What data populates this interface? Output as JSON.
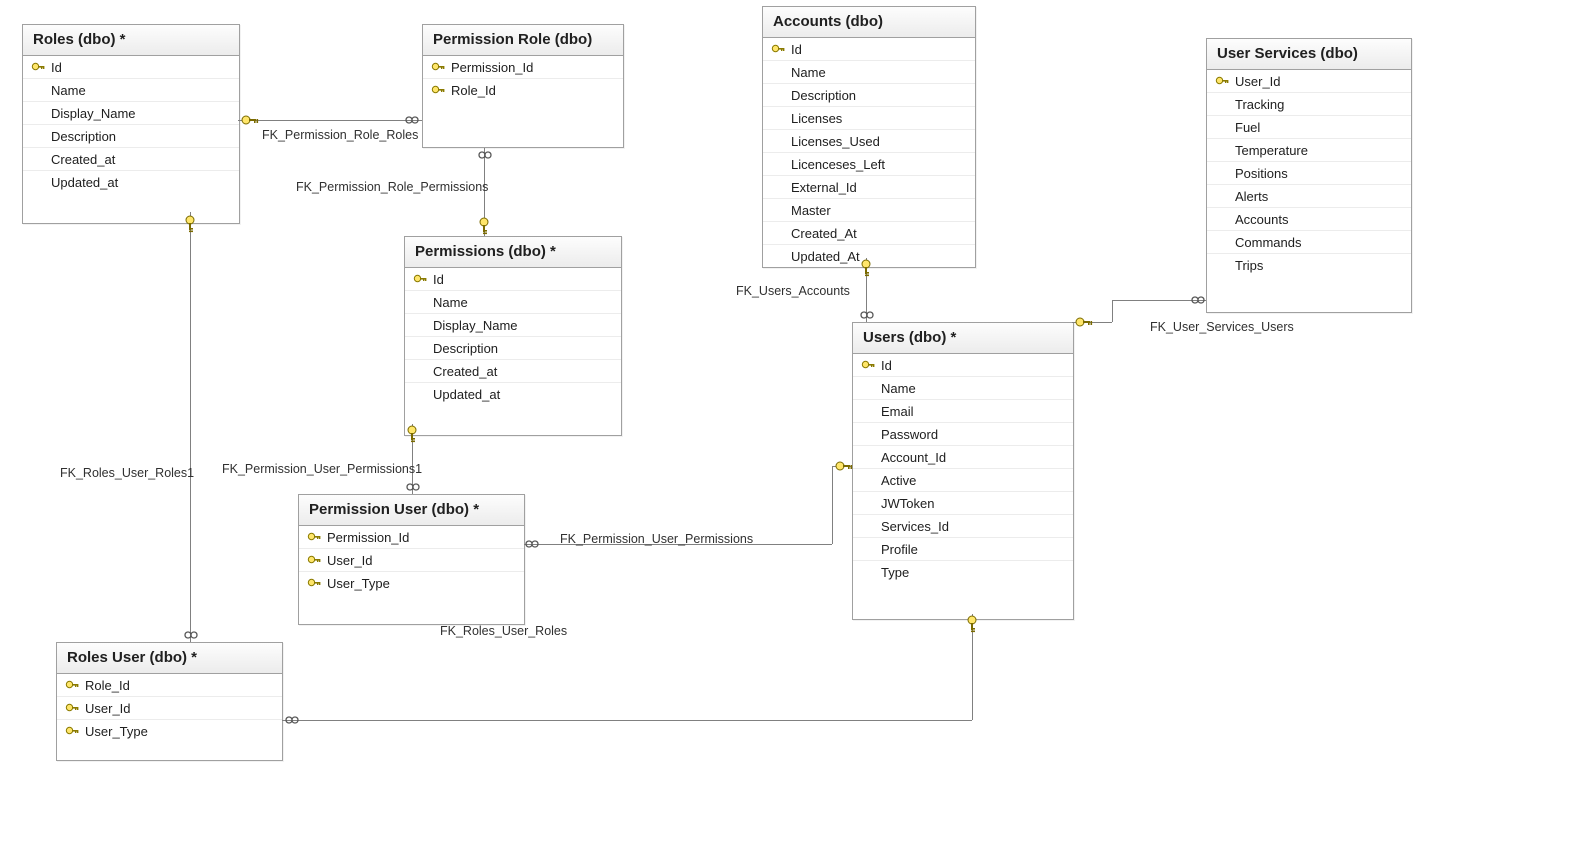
{
  "tables": {
    "roles": {
      "title": "Roles (dbo) *",
      "cols": [
        {
          "key": true,
          "name": "Id"
        },
        {
          "key": false,
          "name": "Name"
        },
        {
          "key": false,
          "name": "Display_Name"
        },
        {
          "key": false,
          "name": "Description"
        },
        {
          "key": false,
          "name": "Created_at"
        },
        {
          "key": false,
          "name": "Updated_at"
        }
      ]
    },
    "permission_role": {
      "title": "Permission Role (dbo)",
      "cols": [
        {
          "key": true,
          "name": "Permission_Id"
        },
        {
          "key": true,
          "name": "Role_Id"
        }
      ]
    },
    "permissions": {
      "title": "Permissions (dbo) *",
      "cols": [
        {
          "key": true,
          "name": "Id"
        },
        {
          "key": false,
          "name": "Name"
        },
        {
          "key": false,
          "name": "Display_Name"
        },
        {
          "key": false,
          "name": "Description"
        },
        {
          "key": false,
          "name": "Created_at"
        },
        {
          "key": false,
          "name": "Updated_at"
        }
      ]
    },
    "permission_user": {
      "title": "Permission User (dbo) *",
      "cols": [
        {
          "key": true,
          "name": "Permission_Id"
        },
        {
          "key": true,
          "name": "User_Id"
        },
        {
          "key": true,
          "name": "User_Type"
        }
      ]
    },
    "roles_user": {
      "title": "Roles User (dbo) *",
      "cols": [
        {
          "key": true,
          "name": "Role_Id"
        },
        {
          "key": true,
          "name": "User_Id"
        },
        {
          "key": true,
          "name": "User_Type"
        }
      ]
    },
    "accounts": {
      "title": "Accounts (dbo)",
      "cols": [
        {
          "key": true,
          "name": "Id"
        },
        {
          "key": false,
          "name": "Name"
        },
        {
          "key": false,
          "name": "Description"
        },
        {
          "key": false,
          "name": "Licenses"
        },
        {
          "key": false,
          "name": "Licenses_Used"
        },
        {
          "key": false,
          "name": "Licenceses_Left"
        },
        {
          "key": false,
          "name": "External_Id"
        },
        {
          "key": false,
          "name": "Master"
        },
        {
          "key": false,
          "name": "Created_At"
        },
        {
          "key": false,
          "name": "Updated_At"
        }
      ]
    },
    "users": {
      "title": "Users (dbo) *",
      "cols": [
        {
          "key": true,
          "name": "Id"
        },
        {
          "key": false,
          "name": "Name"
        },
        {
          "key": false,
          "name": "Email"
        },
        {
          "key": false,
          "name": "Password"
        },
        {
          "key": false,
          "name": "Account_Id"
        },
        {
          "key": false,
          "name": "Active"
        },
        {
          "key": false,
          "name": "JWToken"
        },
        {
          "key": false,
          "name": "Services_Id"
        },
        {
          "key": false,
          "name": "Profile"
        },
        {
          "key": false,
          "name": "Type"
        }
      ]
    },
    "user_services": {
      "title": "User Services (dbo)",
      "cols": [
        {
          "key": true,
          "name": "User_Id"
        },
        {
          "key": false,
          "name": "Tracking"
        },
        {
          "key": false,
          "name": "Fuel"
        },
        {
          "key": false,
          "name": "Temperature"
        },
        {
          "key": false,
          "name": "Positions"
        },
        {
          "key": false,
          "name": "Alerts"
        },
        {
          "key": false,
          "name": "Accounts"
        },
        {
          "key": false,
          "name": "Commands"
        },
        {
          "key": false,
          "name": "Trips"
        }
      ]
    }
  },
  "relationships": {
    "fk_permission_role_roles": "FK_Permission_Role_Roles",
    "fk_permission_role_permissions": "FK_Permission_Role_Permissions",
    "fk_permission_user_permissions1": "FK_Permission_User_Permissions1",
    "fk_permission_user_permissions": "FK_Permission_User_Permissions",
    "fk_roles_user_roles1": "FK_Roles_User_Roles1",
    "fk_roles_user_roles": "FK_Roles_User_Roles",
    "fk_users_accounts": "FK_Users_Accounts",
    "fk_user_services_users": "FK_User_Services_Users"
  }
}
